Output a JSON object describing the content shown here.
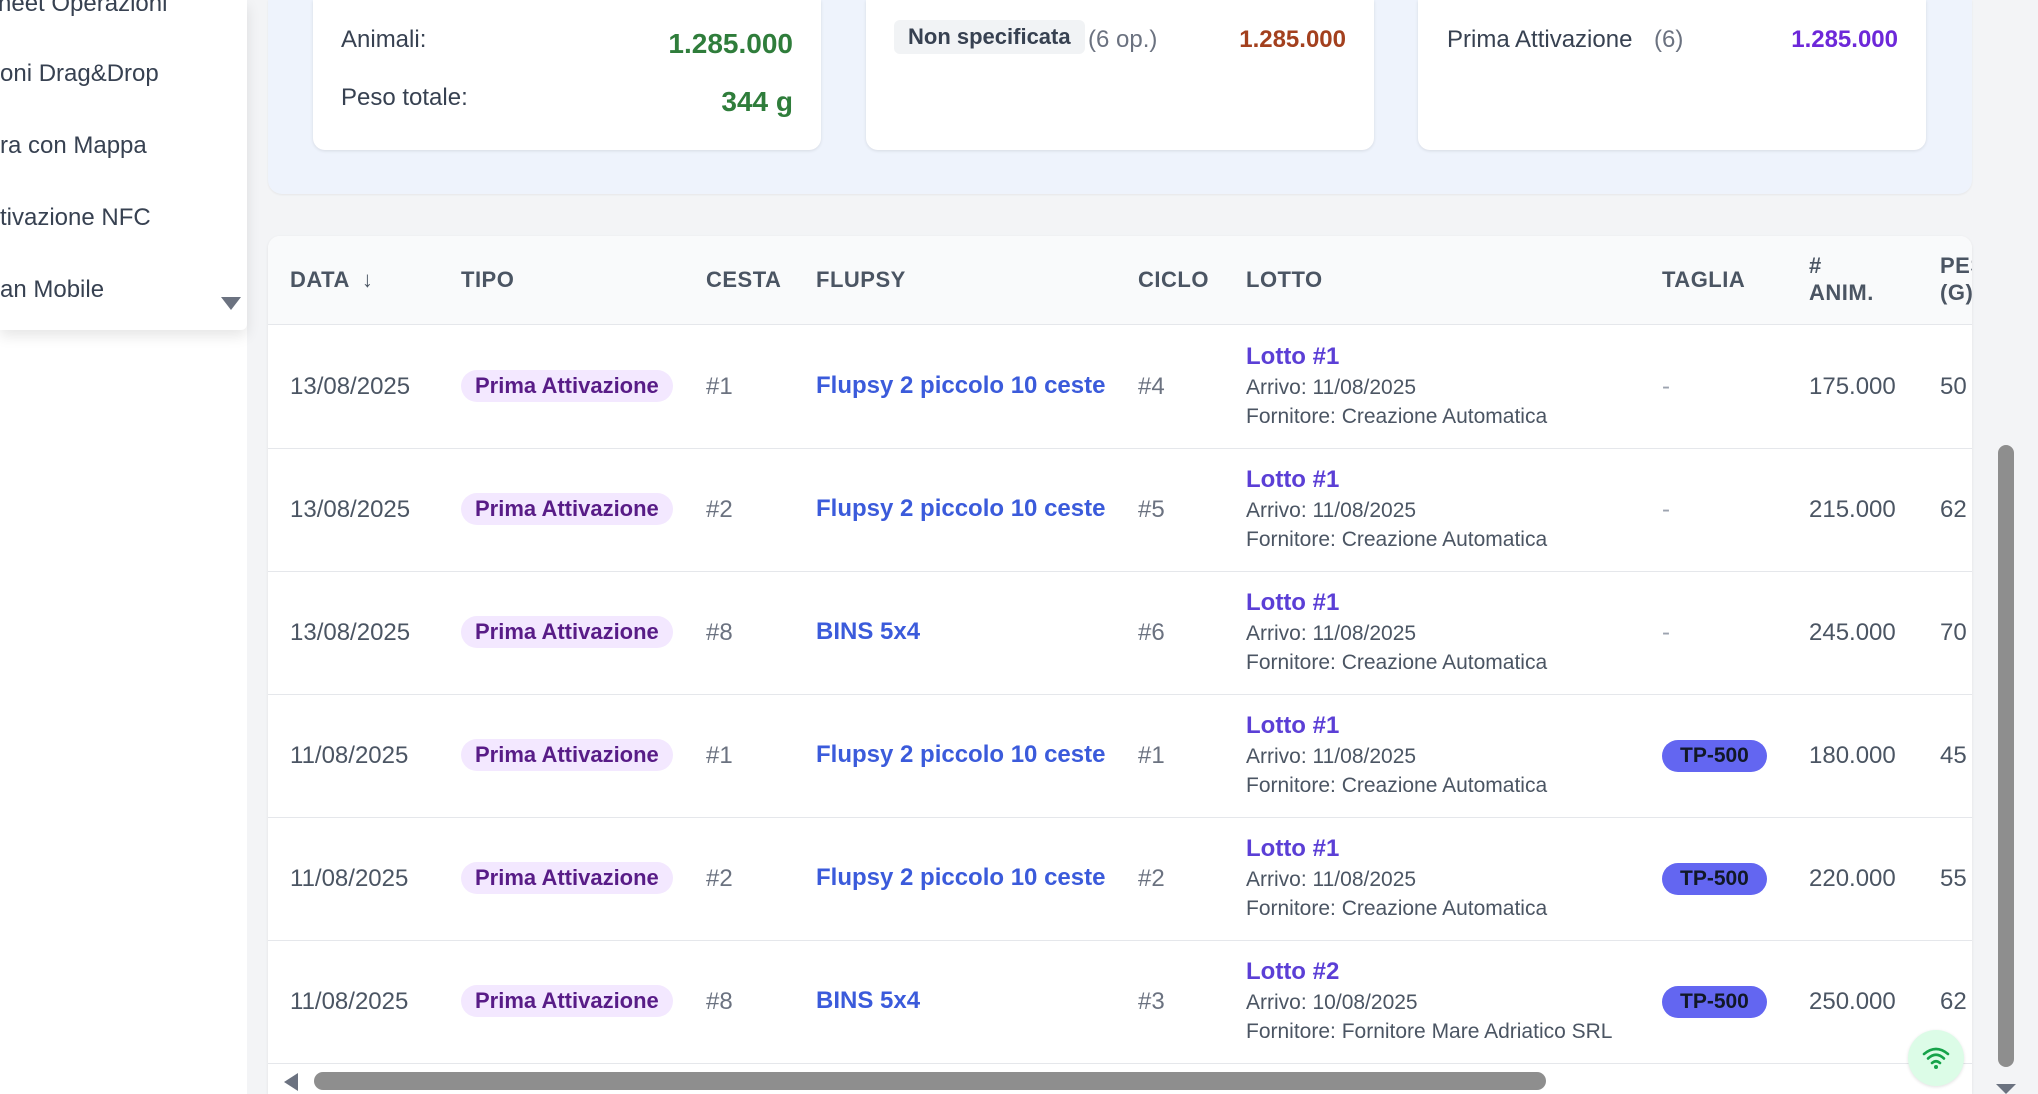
{
  "sidebar": {
    "items": [
      {
        "label": "heet Operazioni"
      },
      {
        "label": "oni Drag&Drop"
      },
      {
        "label": "ra con Mappa"
      },
      {
        "label": "tivazione NFC"
      },
      {
        "label": "an Mobile"
      }
    ]
  },
  "stats": {
    "card1": {
      "animali_label": "Animali:",
      "animali_value": "1.285.000",
      "peso_label": "Peso totale:",
      "peso_value": "344 g"
    },
    "card2": {
      "badge": "Non specificata",
      "count": "(6 op.)",
      "value": "1.285.000"
    },
    "card3": {
      "label": "Prima Attivazione",
      "count": "(6)",
      "value": "1.285.000"
    }
  },
  "table": {
    "headers": {
      "data": "DATA",
      "tipo": "TIPO",
      "cesta": "CESTA",
      "flupsy": "FLUPSY",
      "ciclo": "CICLO",
      "lotto": "LOTTO",
      "taglia": "TAGLIA",
      "anim_line1": "#",
      "anim_line2": "ANIM.",
      "peso_line1": "PESO",
      "peso_line2": "(G)"
    },
    "rows": [
      {
        "data": "13/08/2025",
        "tipo": "Prima Attivazione",
        "cesta": "#1",
        "flupsy": "Flupsy 2 piccolo 10 ceste",
        "ciclo": "#4",
        "lotto": "Lotto #1",
        "arrivo": "Arrivo: 11/08/2025",
        "fornitore": "Fornitore: Creazione Automatica",
        "taglia": "-",
        "anim": "175.000",
        "peso": "50"
      },
      {
        "data": "13/08/2025",
        "tipo": "Prima Attivazione",
        "cesta": "#2",
        "flupsy": "Flupsy 2 piccolo 10 ceste",
        "ciclo": "#5",
        "lotto": "Lotto #1",
        "arrivo": "Arrivo: 11/08/2025",
        "fornitore": "Fornitore: Creazione Automatica",
        "taglia": "-",
        "anim": "215.000",
        "peso": "62"
      },
      {
        "data": "13/08/2025",
        "tipo": "Prima Attivazione",
        "cesta": "#8",
        "flupsy": "BINS 5x4",
        "ciclo": "#6",
        "lotto": "Lotto #1",
        "arrivo": "Arrivo: 11/08/2025",
        "fornitore": "Fornitore: Creazione Automatica",
        "taglia": "-",
        "anim": "245.000",
        "peso": "70"
      },
      {
        "data": "11/08/2025",
        "tipo": "Prima Attivazione",
        "cesta": "#1",
        "flupsy": "Flupsy 2 piccolo 10 ceste",
        "ciclo": "#1",
        "lotto": "Lotto #1",
        "arrivo": "Arrivo: 11/08/2025",
        "fornitore": "Fornitore: Creazione Automatica",
        "taglia": "TP-500",
        "anim": "180.000",
        "peso": "45"
      },
      {
        "data": "11/08/2025",
        "tipo": "Prima Attivazione",
        "cesta": "#2",
        "flupsy": "Flupsy 2 piccolo 10 ceste",
        "ciclo": "#2",
        "lotto": "Lotto #1",
        "arrivo": "Arrivo: 11/08/2025",
        "fornitore": "Fornitore: Creazione Automatica",
        "taglia": "TP-500",
        "anim": "220.000",
        "peso": "55"
      },
      {
        "data": "11/08/2025",
        "tipo": "Prima Attivazione",
        "cesta": "#8",
        "flupsy": "BINS 5x4",
        "ciclo": "#3",
        "lotto": "Lotto #2",
        "arrivo": "Arrivo: 10/08/2025",
        "fornitore": "Fornitore: Fornitore Mare Adriatico SRL",
        "taglia": "TP-500",
        "anim": "250.000",
        "peso": "62"
      }
    ]
  },
  "colors": {
    "green": "#2f7d3b",
    "red": "#a3401e",
    "purple": "#6d28d9",
    "link_blue": "#3b5bdb",
    "badge_indigo": "#6366f1"
  },
  "icons": {
    "sort": "arrow-down-icon",
    "status": "wifi-icon"
  }
}
